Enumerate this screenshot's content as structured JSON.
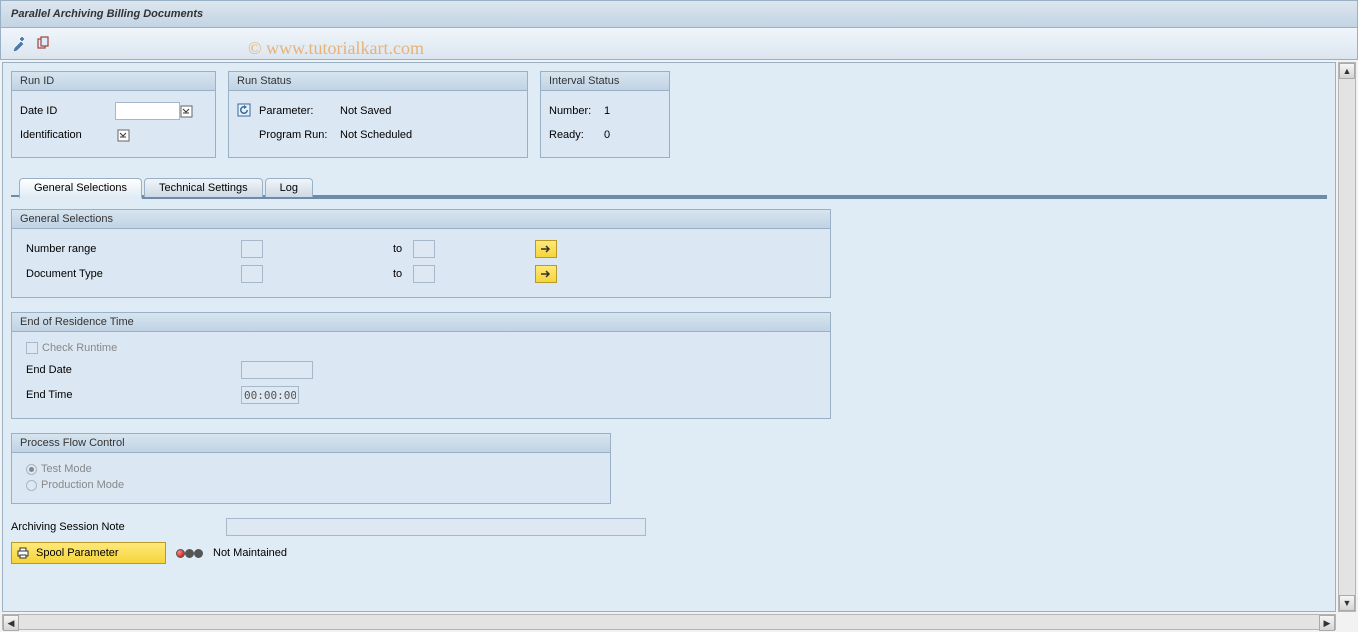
{
  "title": "Parallel Archiving Billing Documents",
  "watermark": "© www.tutorialkart.com",
  "run_id": {
    "legend": "Run ID",
    "date_id_label": "Date ID",
    "date_id_value": "",
    "ident_label": "Identification",
    "ident_value": ""
  },
  "run_status": {
    "legend": "Run Status",
    "param_label": "Parameter:",
    "param_value": "Not Saved",
    "prog_label": "Program Run:",
    "prog_value": "Not Scheduled"
  },
  "interval_status": {
    "legend": "Interval Status",
    "number_label": "Number:",
    "number_value": "1",
    "ready_label": "Ready:",
    "ready_value": "0"
  },
  "tabs": {
    "t1": "General Selections",
    "t2": "Technical Settings",
    "t3": "Log"
  },
  "general_selections": {
    "legend": "General Selections",
    "number_range_label": "Number range",
    "doc_type_label": "Document Type",
    "to_label": "to"
  },
  "end_residence": {
    "legend": "End of Residence Time",
    "check_runtime_label": "Check Runtime",
    "end_date_label": "End Date",
    "end_date_value": "",
    "end_time_label": "End Time",
    "end_time_value": "00:00:00"
  },
  "process_flow": {
    "legend": "Process Flow Control",
    "test_label": "Test Mode",
    "prod_label": "Production Mode"
  },
  "note": {
    "label": "Archiving Session Note",
    "value": ""
  },
  "spool": {
    "button_label": "Spool Parameter",
    "status_label": "Not Maintained"
  }
}
